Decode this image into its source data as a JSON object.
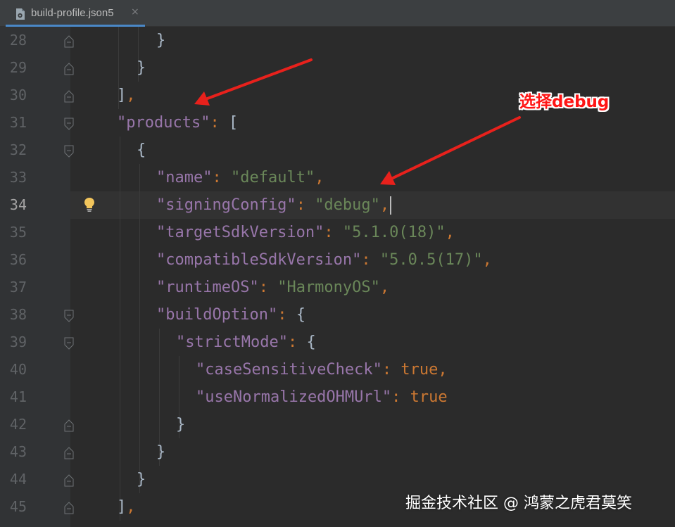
{
  "tab": {
    "filename": "build-profile.json5",
    "close_glyph": "×",
    "icon": "json5-file-icon"
  },
  "editor": {
    "active_line": 34,
    "line_numbers": [
      "28",
      "29",
      "30",
      "31",
      "32",
      "33",
      "34",
      "35",
      "36",
      "37",
      "38",
      "39",
      "40",
      "41",
      "42",
      "43",
      "44",
      "45"
    ],
    "lines": {
      "l28": {
        "brace": "}"
      },
      "l29": {
        "brace": "}"
      },
      "l30": {
        "bracket": "]",
        "comma": ","
      },
      "l31": {
        "key": "\"products\"",
        "colon": ": ",
        "bracket": "["
      },
      "l32": {
        "brace": "{"
      },
      "l33": {
        "key": "\"name\"",
        "colon": ": ",
        "value": "\"default\"",
        "comma": ","
      },
      "l34": {
        "key": "\"signingConfig\"",
        "colon": ": ",
        "value": "\"debug\"",
        "comma": ","
      },
      "l35": {
        "key": "\"targetSdkVersion\"",
        "colon": ": ",
        "value": "\"5.1.0(18)\"",
        "comma": ","
      },
      "l36": {
        "key": "\"compatibleSdkVersion\"",
        "colon": ": ",
        "value": "\"5.0.5(17)\"",
        "comma": ","
      },
      "l37": {
        "key": "\"runtimeOS\"",
        "colon": ": ",
        "value": "\"HarmonyOS\"",
        "comma": ","
      },
      "l38": {
        "key": "\"buildOption\"",
        "colon": ": ",
        "brace": "{"
      },
      "l39": {
        "key": "\"strictMode\"",
        "colon": ": ",
        "brace": "{"
      },
      "l40": {
        "key": "\"caseSensitiveCheck\"",
        "colon": ": ",
        "value": "true",
        "comma": ","
      },
      "l41": {
        "key": "\"useNormalizedOHMUrl\"",
        "colon": ": ",
        "value": "true"
      },
      "l42": {
        "brace": "}"
      },
      "l43": {
        "brace": "}"
      },
      "l44": {
        "brace": "}"
      },
      "l45": {
        "bracket": "]",
        "comma": ","
      }
    }
  },
  "annotation": {
    "label": "选择debug",
    "color": "#ff1515"
  },
  "watermark": "掘金技术社区 @ 鸿蒙之虎君莫笑",
  "colors": {
    "background": "#2b2b2b",
    "json_key": "#9876aa",
    "json_string": "#6a8759",
    "json_keyword": "#cc7832",
    "tab_underline": "#4a88c7"
  }
}
